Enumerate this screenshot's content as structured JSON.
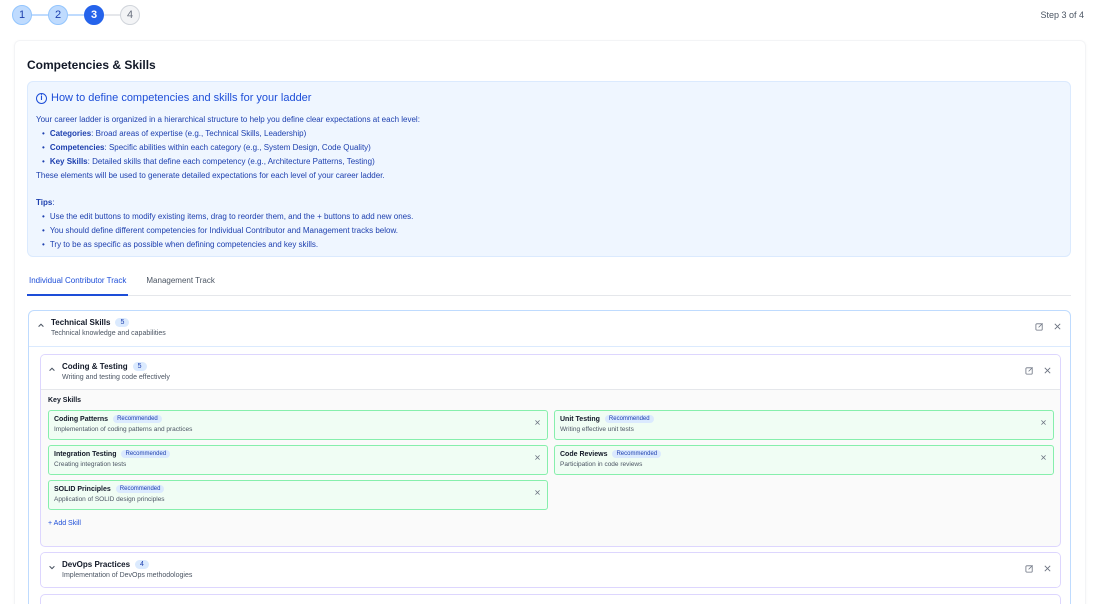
{
  "stepper": {
    "steps": [
      "1",
      "2",
      "3",
      "4"
    ],
    "current_label": "Step 3 of 4"
  },
  "section_title": "Competencies & Skills",
  "info": {
    "title": "How to define competencies and skills for your ladder",
    "intro": "Your career ladder is organized in a hierarchical structure to help you define clear expectations at each level:",
    "items": [
      {
        "term": "Categories",
        "text": ": Broad areas of expertise (e.g., Technical Skills, Leadership)"
      },
      {
        "term": "Competencies",
        "text": ": Specific abilities within each category (e.g., System Design, Code Quality)"
      },
      {
        "term": "Key Skills",
        "text": ": Detailed skills that define each competency (e.g., Architecture Patterns, Testing)"
      }
    ],
    "outro": "These elements will be used to generate detailed expectations for each level of your career ladder.",
    "tips_title": "Tips",
    "tips_colon": ":",
    "tips": [
      "Use the edit buttons to modify existing items, drag to reorder them, and the + buttons to add new ones.",
      "You should define different competencies for Individual Contributor and Management tracks below.",
      "Try to be as specific as possible when defining competencies and key skills."
    ]
  },
  "tabs": [
    {
      "label": "Individual Contributor Track",
      "active": true
    },
    {
      "label": "Management Track",
      "active": false
    }
  ],
  "category": {
    "name": "Technical Skills",
    "count": "5",
    "description": "Technical knowledge and capabilities",
    "competencies": [
      {
        "name": "Coding & Testing",
        "count": "5",
        "description": "Writing and testing code effectively",
        "key_skills_label": "Key Skills",
        "skills": [
          {
            "name": "Coding Patterns",
            "badge": "Recommended",
            "description": "Implementation of coding patterns and practices"
          },
          {
            "name": "Unit Testing",
            "badge": "Recommended",
            "description": "Writing effective unit tests"
          },
          {
            "name": "Integration Testing",
            "badge": "Recommended",
            "description": "Creating integration tests"
          },
          {
            "name": "Code Reviews",
            "badge": "Recommended",
            "description": "Participation in code reviews"
          },
          {
            "name": "SOLID Principles",
            "badge": "Recommended",
            "description": "Application of SOLID design principles"
          }
        ],
        "add_skill_label": "+ Add Skill"
      },
      {
        "name": "DevOps Practices",
        "count": "4",
        "description": "Implementation of DevOps methodologies"
      }
    ]
  },
  "icons": {
    "edit": "edit-icon",
    "close": "close-icon",
    "chevron_up": "chevron-up-icon",
    "chevron_down": "chevron-down-icon",
    "info": "info-icon"
  },
  "colors": {
    "accent": "#2563eb",
    "info_bg": "#eff6ff",
    "skill_border": "#86efac",
    "skill_bg": "#f0fdf4"
  }
}
